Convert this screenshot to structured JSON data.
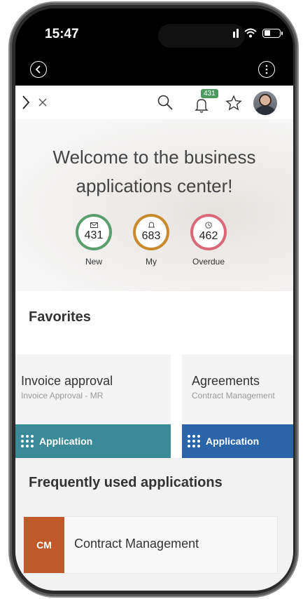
{
  "status_bar": {
    "time": "15:47"
  },
  "header": {
    "notification_count": "431"
  },
  "hero": {
    "title": "Welcome to the business applications center!",
    "metrics": [
      {
        "value": "431",
        "label": "New",
        "icon": "envelope-icon",
        "color": "#5a9e6e"
      },
      {
        "value": "683",
        "label": "My",
        "icon": "bell-icon",
        "color": "#c88a2d"
      },
      {
        "value": "462",
        "label": "Overdue",
        "icon": "clock-icon",
        "color": "#d9687a"
      }
    ]
  },
  "favorites": {
    "title": "Favorites",
    "cards": [
      {
        "title": "Invoice approval",
        "subtitle": "Invoice Approval - MR",
        "type_label": "Application",
        "color": "#3a8a99"
      },
      {
        "title": "Agreements",
        "subtitle": "Contract Management",
        "type_label": "Application",
        "color": "#2b64a8"
      }
    ]
  },
  "frequent": {
    "title": "Frequently used applications",
    "items": [
      {
        "abbr": "CM",
        "label": "Contract Management",
        "color": "#c05a2a"
      }
    ]
  }
}
